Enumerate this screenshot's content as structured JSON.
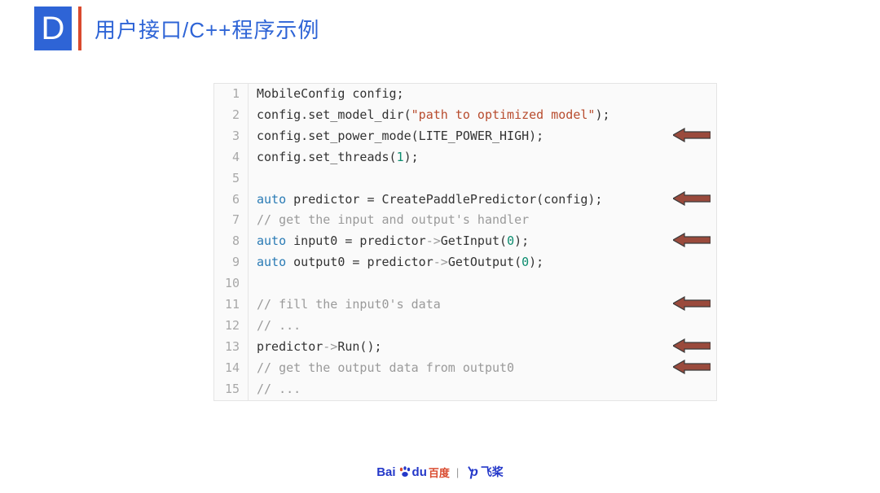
{
  "header": {
    "badge_letter": "D",
    "title": "用户接口/C++程序示例"
  },
  "code": {
    "lines": [
      {
        "n": 1,
        "tokens": [
          {
            "t": "MobileConfig config;",
            "c": ""
          }
        ]
      },
      {
        "n": 2,
        "tokens": [
          {
            "t": "config.set_model_dir(",
            "c": ""
          },
          {
            "t": "\"path to optimized model\"",
            "c": "str"
          },
          {
            "t": ");",
            "c": ""
          }
        ]
      },
      {
        "n": 3,
        "tokens": [
          {
            "t": "config.set_power_mode(LITE_POWER_HIGH);",
            "c": ""
          }
        ]
      },
      {
        "n": 4,
        "tokens": [
          {
            "t": "config.set_threads(",
            "c": ""
          },
          {
            "t": "1",
            "c": "num"
          },
          {
            "t": ");",
            "c": ""
          }
        ]
      },
      {
        "n": 5,
        "tokens": [
          {
            "t": "",
            "c": ""
          }
        ]
      },
      {
        "n": 6,
        "tokens": [
          {
            "t": "auto",
            "c": "kw"
          },
          {
            "t": " predictor = CreatePaddlePredictor(config);",
            "c": ""
          }
        ]
      },
      {
        "n": 7,
        "tokens": [
          {
            "t": "// get the input and output's handler",
            "c": "cmt"
          }
        ]
      },
      {
        "n": 8,
        "tokens": [
          {
            "t": "auto",
            "c": "kw"
          },
          {
            "t": " input0 = predictor",
            "c": ""
          },
          {
            "t": "->",
            "c": "op"
          },
          {
            "t": "GetInput(",
            "c": ""
          },
          {
            "t": "0",
            "c": "num"
          },
          {
            "t": ");",
            "c": ""
          }
        ]
      },
      {
        "n": 9,
        "tokens": [
          {
            "t": "auto",
            "c": "kw"
          },
          {
            "t": " output0 = predictor",
            "c": ""
          },
          {
            "t": "->",
            "c": "op"
          },
          {
            "t": "GetOutput(",
            "c": ""
          },
          {
            "t": "0",
            "c": "num"
          },
          {
            "t": ");",
            "c": ""
          }
        ]
      },
      {
        "n": 10,
        "tokens": [
          {
            "t": "",
            "c": ""
          }
        ]
      },
      {
        "n": 11,
        "tokens": [
          {
            "t": "// fill the input0's data",
            "c": "cmt"
          }
        ]
      },
      {
        "n": 12,
        "tokens": [
          {
            "t": "// ...",
            "c": "cmt"
          }
        ]
      },
      {
        "n": 13,
        "tokens": [
          {
            "t": "predictor",
            "c": ""
          },
          {
            "t": "->",
            "c": "op"
          },
          {
            "t": "Run();",
            "c": ""
          }
        ]
      },
      {
        "n": 14,
        "tokens": [
          {
            "t": "// get the output data from output0",
            "c": "cmt"
          }
        ]
      },
      {
        "n": 15,
        "tokens": [
          {
            "t": "// ...",
            "c": "cmt"
          }
        ]
      }
    ]
  },
  "arrows": {
    "positions_line": [
      3,
      6,
      8,
      11,
      13,
      14
    ],
    "fill": "#9a4a3c",
    "stroke": "#3a3a3a"
  },
  "footer": {
    "baidu_en": "Bai",
    "baidu_du": "du",
    "baidu_cn": "百度",
    "divider": "|",
    "paddle_pp": "ᐠp",
    "paddle_cn": "飞桨"
  }
}
